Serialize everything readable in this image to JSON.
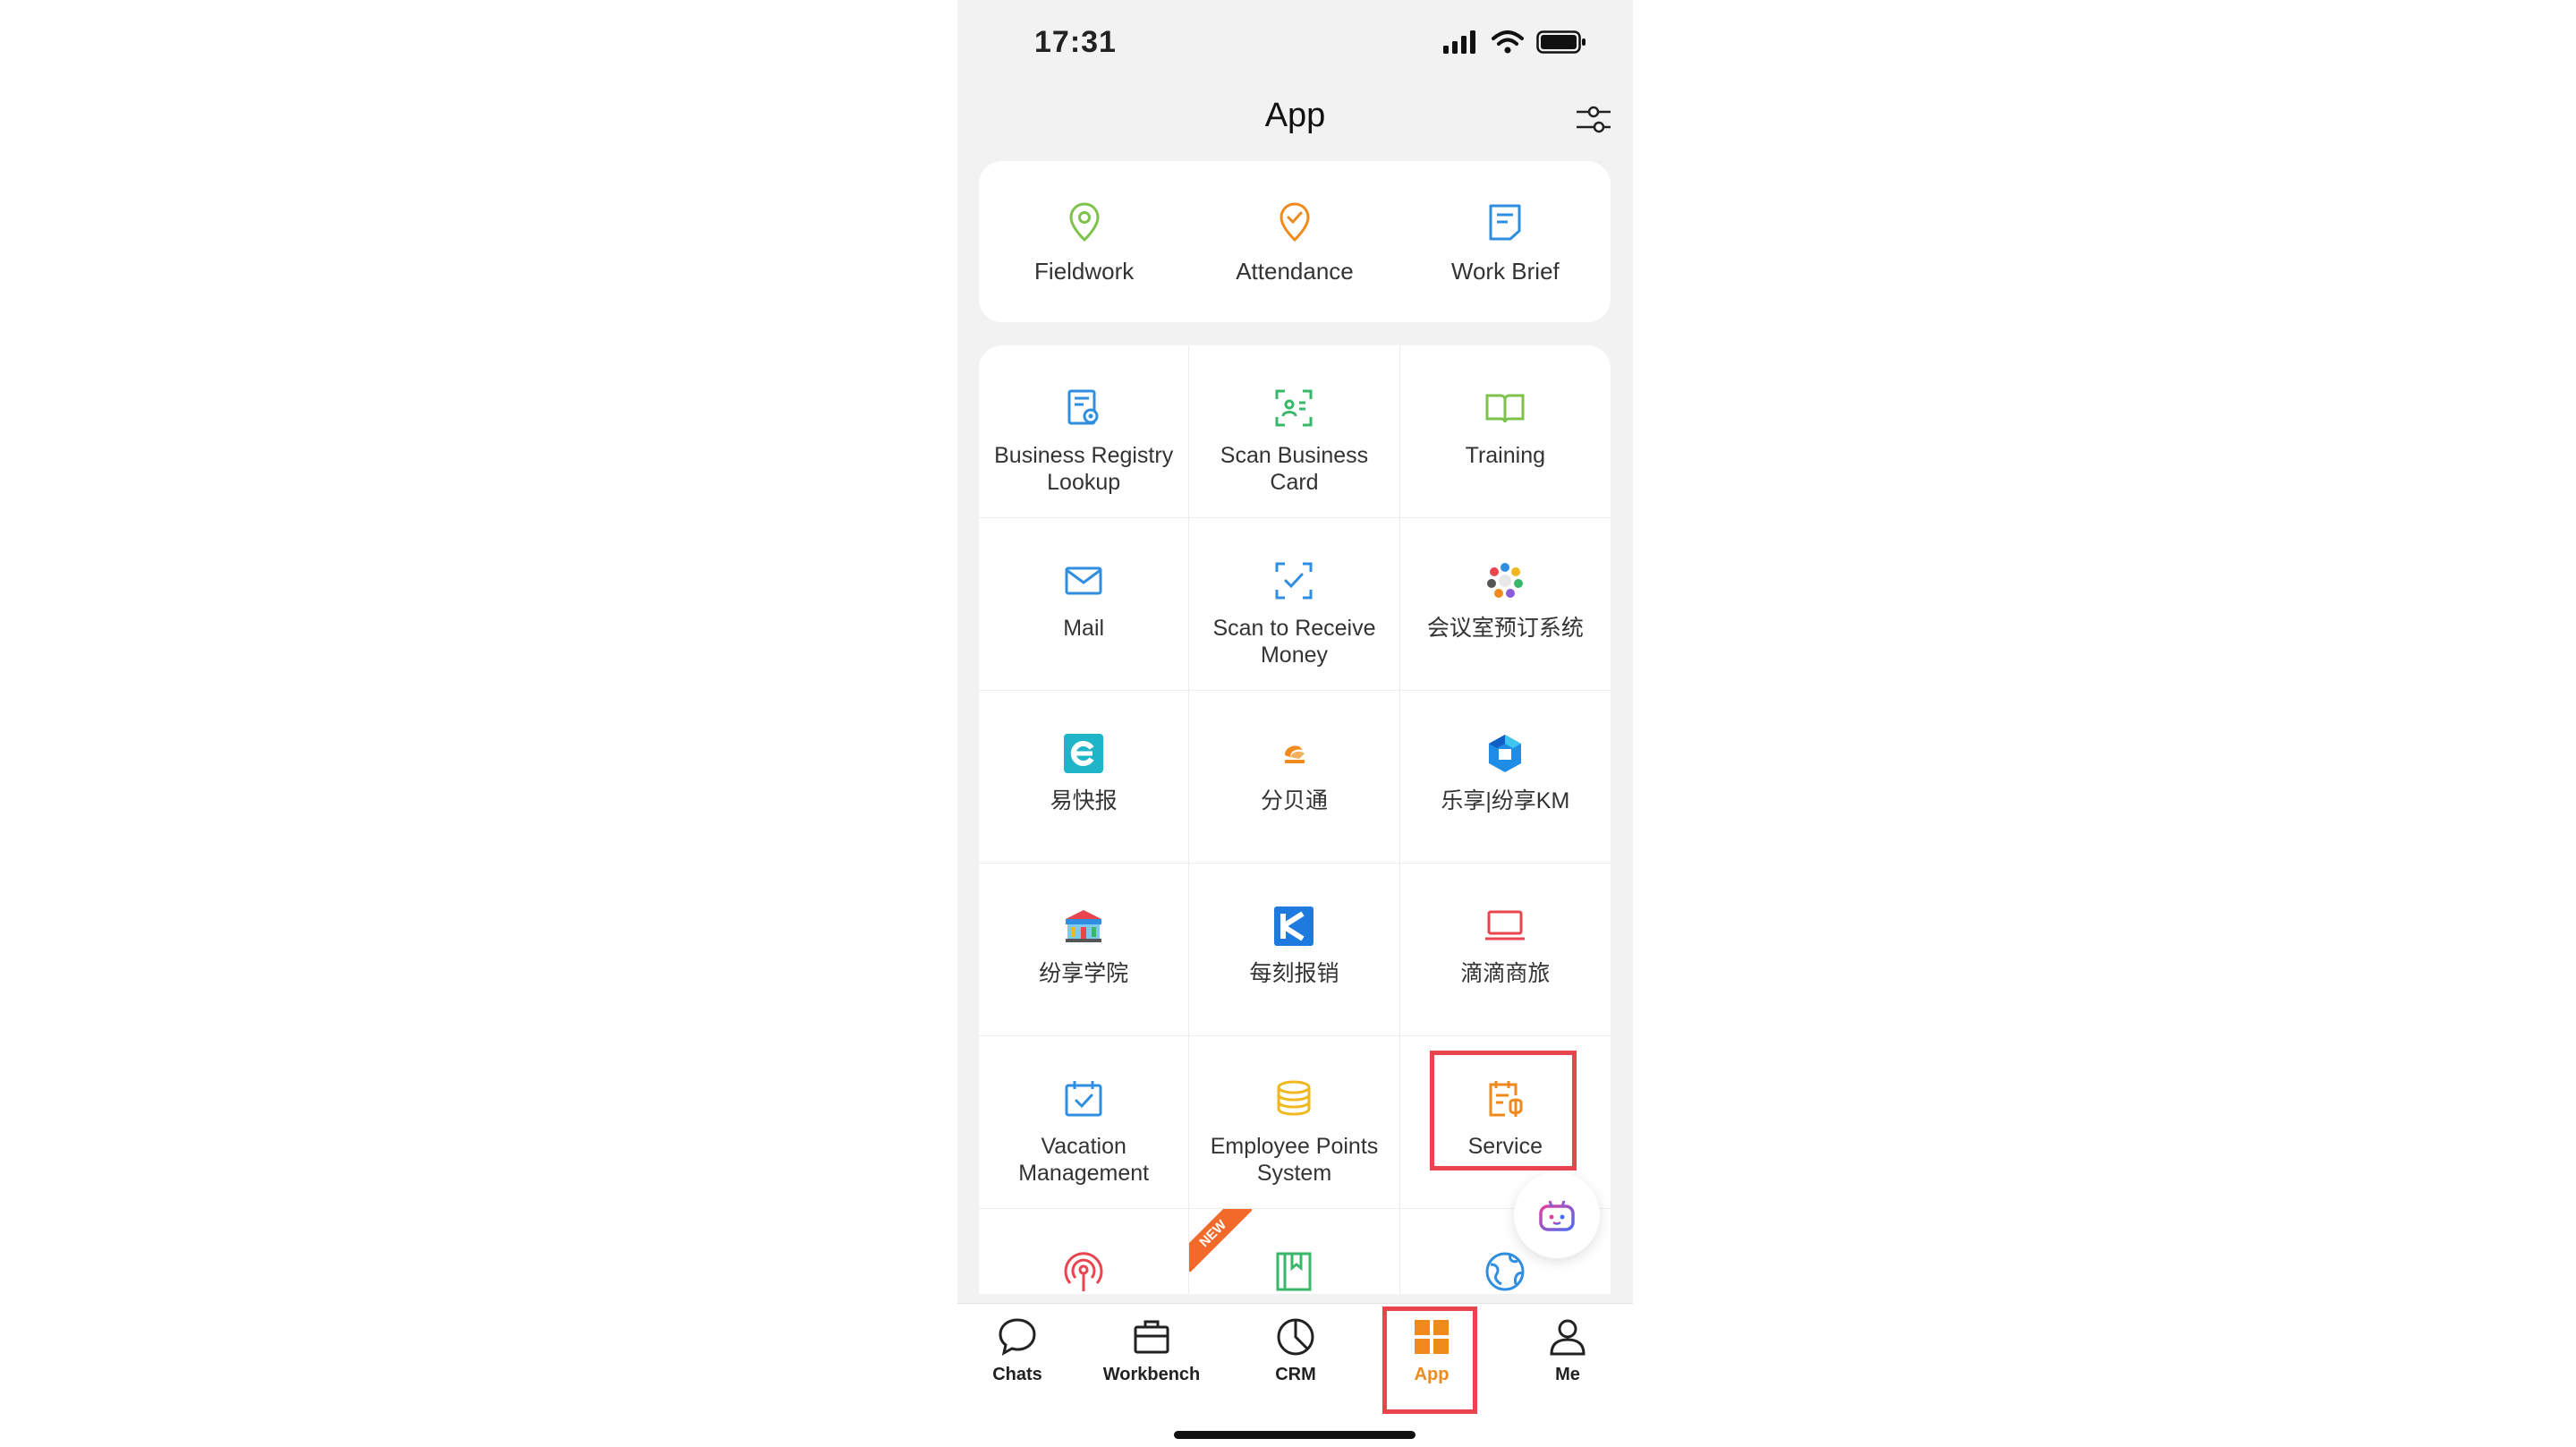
{
  "status_bar": {
    "time": "17:31"
  },
  "header": {
    "title": "App"
  },
  "top_apps": [
    {
      "label": "Fieldwork",
      "icon": "location-pin-icon"
    },
    {
      "label": "Attendance",
      "icon": "attendance-check-icon"
    },
    {
      "label": "Work Brief",
      "icon": "work-brief-icon"
    }
  ],
  "apps": [
    {
      "label": "Business Registry Lookup",
      "icon": "registry-lookup-icon"
    },
    {
      "label": "Scan Business Card",
      "icon": "scan-card-icon"
    },
    {
      "label": "Training",
      "icon": "book-icon"
    },
    {
      "label": "Mail",
      "icon": "mail-icon"
    },
    {
      "label": "Scan to Receive Money",
      "icon": "scan-money-icon"
    },
    {
      "label": "会议室预订系统",
      "icon": "meeting-room-icon"
    },
    {
      "label": "易快报",
      "icon": "yikuaibao-icon"
    },
    {
      "label": "分贝通",
      "icon": "fenbeitong-icon"
    },
    {
      "label": "乐享|纷享KM",
      "icon": "lexiang-km-icon"
    },
    {
      "label": "纷享学院",
      "icon": "academy-icon"
    },
    {
      "label": "每刻报销",
      "icon": "maycur-icon"
    },
    {
      "label": "滴滴商旅",
      "icon": "didi-travel-icon"
    },
    {
      "label": "Vacation Management",
      "icon": "vacation-calendar-icon"
    },
    {
      "label": "Employee Points System",
      "icon": "points-coins-icon"
    },
    {
      "label": "Service",
      "icon": "service-icon"
    },
    {
      "label": "",
      "icon": "broadcast-icon"
    },
    {
      "label": "",
      "icon": "notebook-icon",
      "badge": "NEW"
    },
    {
      "label": "",
      "icon": "globe-icon"
    }
  ],
  "tabs": [
    {
      "label": "Chats",
      "icon": "chat-bubble-icon"
    },
    {
      "label": "Workbench",
      "icon": "briefcase-icon"
    },
    {
      "label": "CRM",
      "icon": "pie-chart-icon"
    },
    {
      "label": "App",
      "icon": "app-grid-icon",
      "active": true
    },
    {
      "label": "Me",
      "icon": "person-icon"
    }
  ],
  "colors": {
    "accent": "#f08a1c",
    "highlight": "#e8454f",
    "blue": "#2f8ee0",
    "green": "#39b76a"
  }
}
